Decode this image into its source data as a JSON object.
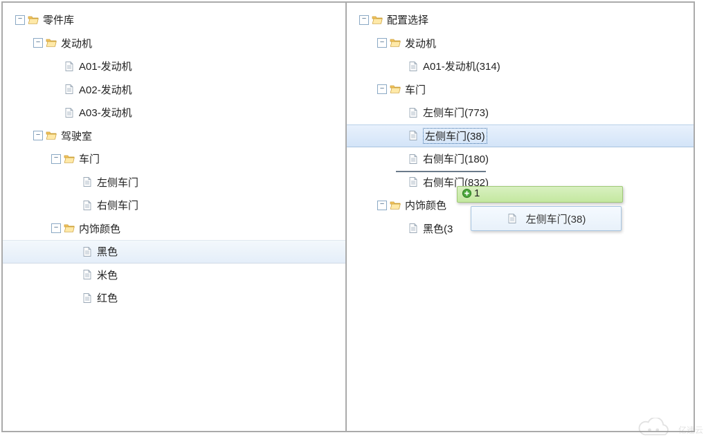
{
  "left": {
    "root": "零件库",
    "n1": "发动机",
    "n1a": "A01-发动机",
    "n1b": "A02-发动机",
    "n1c": "A03-发动机",
    "n2": "驾驶室",
    "n2a": "车门",
    "n2a1": "左侧车门",
    "n2a2": "右侧车门",
    "n2b": "内饰颜色",
    "n2b1": "黑色",
    "n2b2": "米色",
    "n2b3": "红色"
  },
  "right": {
    "root": "配置选择",
    "n1": "发动机",
    "n1a": "A01-发动机(314)",
    "n2": "车门",
    "n2a": "左侧车门(773)",
    "n2b": "左侧车门(38)",
    "n2c": "右侧车门(180)",
    "n2d": "右侧车门(832)",
    "n3": "内饰颜色",
    "n3a": "黑色(3"
  },
  "drag": {
    "count": "1",
    "item": "左侧车门(38)"
  },
  "watermark": "亿速云"
}
